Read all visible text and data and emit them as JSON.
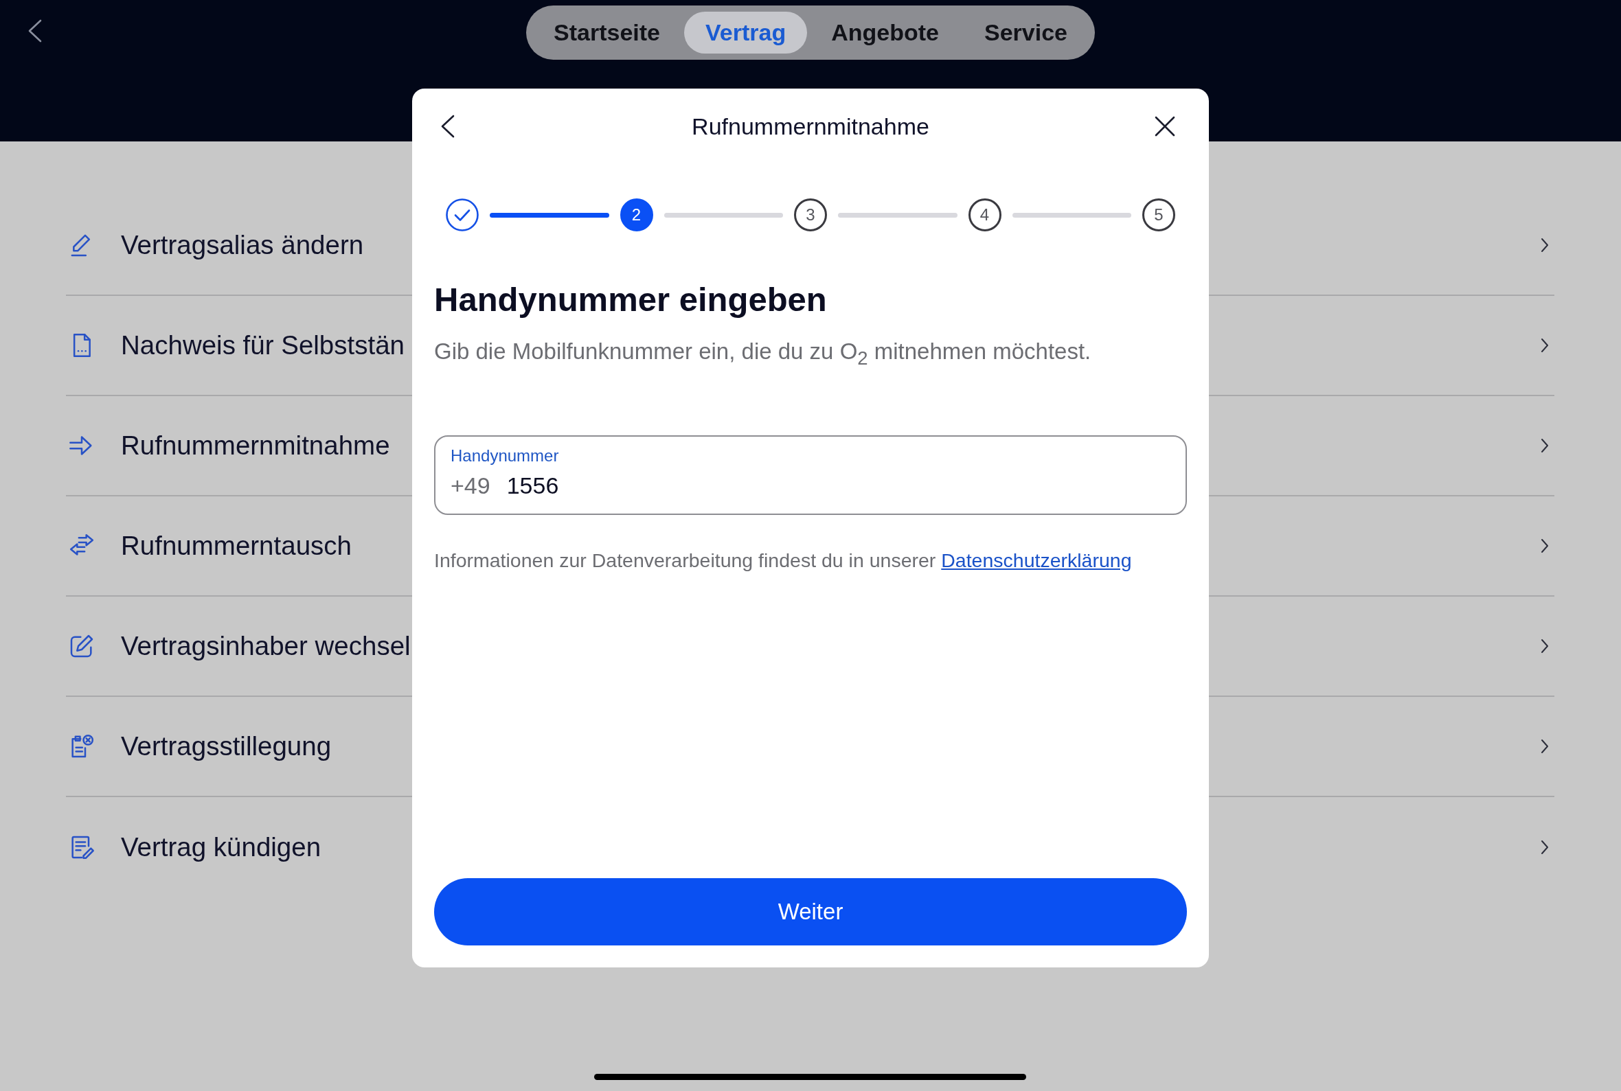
{
  "top_bar": {
    "tabs": [
      {
        "label": "Startseite",
        "selected": false
      },
      {
        "label": "Vertrag",
        "selected": true
      },
      {
        "label": "Angebote",
        "selected": false
      },
      {
        "label": "Service",
        "selected": false
      }
    ]
  },
  "menu": {
    "items": [
      {
        "label": "Vertragsalias ändern"
      },
      {
        "label": "Nachweis für Selbststän"
      },
      {
        "label": "Rufnummernmitnahme"
      },
      {
        "label": "Rufnummerntausch"
      },
      {
        "label": "Vertragsinhaber wechsel"
      },
      {
        "label": "Vertragsstillegung"
      },
      {
        "label": "Vertrag kündigen"
      }
    ]
  },
  "modal": {
    "title": "Rufnummernmitnahme",
    "steps": [
      {
        "done": true,
        "selected": false
      },
      {
        "label": "2",
        "done": false,
        "selected": true
      },
      {
        "label": "3",
        "done": false,
        "selected": false
      },
      {
        "label": "4",
        "done": false,
        "selected": false
      },
      {
        "label": "5",
        "done": false,
        "selected": false
      }
    ],
    "heading": "Handynummer eingeben",
    "subtitle": "Gib die Mobilfunknummer ein, die du zu O$_{2}$ mitnehmen möchtest.",
    "phone_field": {
      "label": "Handynummer",
      "prefix": "+49",
      "value": "1556"
    },
    "privacy_note": {
      "text": "Informationen zur Datenverarbeitung findest du in unserer",
      "link": "Datenschutzerklärung"
    },
    "button": "Weiter"
  }
}
